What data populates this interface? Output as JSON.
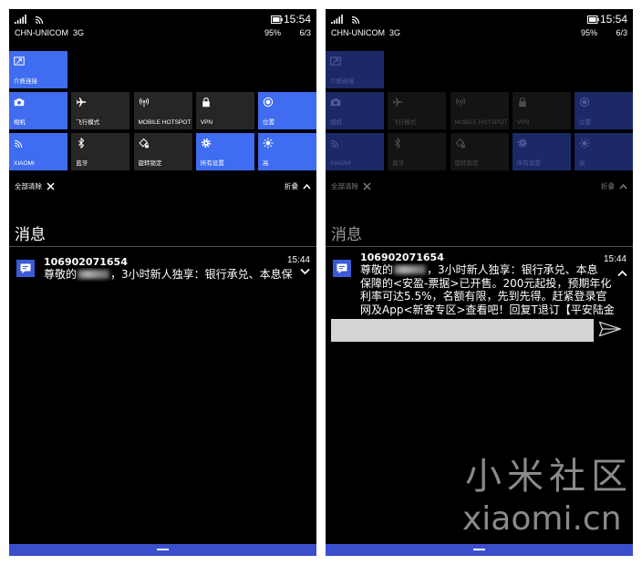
{
  "colors": {
    "page_bg": "#ffffff",
    "screen_bg": "#000000",
    "accent": "#3f6cf0",
    "tile_off": "#262626",
    "accent_dim": "#1b2a66",
    "tile_off_dim": "#141414",
    "nav_bar": "#3b4fcc",
    "notification_icon": "#3a5ad6",
    "reply_box": "#d4d4d4",
    "divider": "#4a4a4a",
    "watermark": "#8a8a8a"
  },
  "watermark": {
    "line1": "小米社区",
    "line2": "xiaomi.cn"
  },
  "phones": [
    {
      "dimmed": false,
      "status": {
        "time": "15:54",
        "carrier": "CHN-UNICOM",
        "network": "3G",
        "battery": "95%",
        "date": "6/3"
      },
      "tile_rows": [
        [
          {
            "label": "介质连接",
            "icon": "project-icon",
            "active": true
          }
        ],
        [
          {
            "label": "相机",
            "icon": "camera-icon",
            "active": true
          },
          {
            "label": "飞行模式",
            "icon": "airplane-icon",
            "active": false
          },
          {
            "label": "MOBILE HOTSPOT",
            "icon": "hotspot-icon",
            "active": false
          },
          {
            "label": "VPN",
            "icon": "lock-icon",
            "active": false
          },
          {
            "label": "位置",
            "icon": "location-icon",
            "active": true
          }
        ],
        [
          {
            "label": "XIAOMI",
            "icon": "wifi-icon",
            "active": true
          },
          {
            "label": "蓝牙",
            "icon": "bluetooth-icon",
            "active": false
          },
          {
            "label": "旋转锁定",
            "icon": "rotation-lock-icon",
            "active": false
          },
          {
            "label": "所有设置",
            "icon": "gear-icon",
            "active": true
          },
          {
            "label": "高",
            "icon": "brightness-icon",
            "active": true
          }
        ]
      ],
      "clear_all": "全部清除",
      "collapse": "折叠",
      "section_title": "消息",
      "notification": {
        "sender": "106902071654",
        "time": "15:44",
        "expanded": false,
        "greeting": "尊敬的",
        "line1_rest": "，3小时新人独享：银行承兑、本息保",
        "more_lines": []
      }
    },
    {
      "dimmed": true,
      "status": {
        "time": "15:54",
        "carrier": "CHN-UNICOM",
        "network": "3G",
        "battery": "95%",
        "date": "6/3"
      },
      "tile_rows": [
        [
          {
            "label": "介质连接",
            "icon": "project-icon",
            "active": true
          }
        ],
        [
          {
            "label": "相机",
            "icon": "camera-icon",
            "active": true
          },
          {
            "label": "飞行模式",
            "icon": "airplane-icon",
            "active": false
          },
          {
            "label": "MOBILE HOTSPOT",
            "icon": "hotspot-icon",
            "active": false
          },
          {
            "label": "VPN",
            "icon": "lock-icon",
            "active": false
          },
          {
            "label": "位置",
            "icon": "location-icon",
            "active": true
          }
        ],
        [
          {
            "label": "XIAOMI",
            "icon": "wifi-icon",
            "active": true
          },
          {
            "label": "蓝牙",
            "icon": "bluetooth-icon",
            "active": false
          },
          {
            "label": "旋转锁定",
            "icon": "rotation-lock-icon",
            "active": false
          },
          {
            "label": "所有设置",
            "icon": "gear-icon",
            "active": true
          },
          {
            "label": "高",
            "icon": "brightness-icon",
            "active": true
          }
        ]
      ],
      "clear_all": "全部清除",
      "collapse": "折叠",
      "section_title": "消息",
      "notification": {
        "sender": "106902071654",
        "time": "15:44",
        "expanded": true,
        "greeting": "尊敬的",
        "line1_rest": "，3小时新人独享：银行承兑、本息",
        "more_lines": [
          "保障的<安盈-票据>已开售。200元起投，预期年化",
          "利率可达5.5%，名额有限，先到先得。赶紧登录官",
          "网及App<新客专区>查看吧！回复T退订【平安陆金"
        ]
      }
    }
  ]
}
